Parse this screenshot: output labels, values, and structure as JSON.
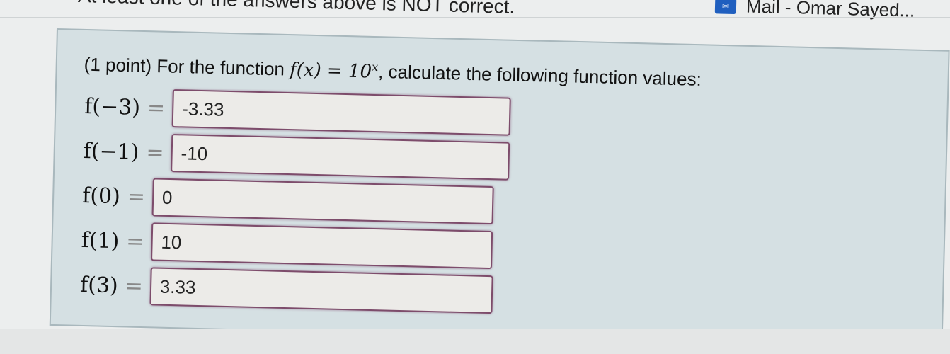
{
  "warning_text": "At least one of the answers above is NOT correct.",
  "taskbar": {
    "mail_label": "Mail - Omar Sayed...",
    "icon": "mail-icon"
  },
  "problem": {
    "points": "(1 point)",
    "intro": "For the function",
    "function": "f(x) = 10",
    "exponent": "x",
    "tail": ", calculate the following function values:"
  },
  "rows": [
    {
      "label": "f(−3)",
      "answer": "-3.33"
    },
    {
      "label": "f(−1)",
      "answer": "-10"
    },
    {
      "label": "f(0)",
      "answer": "0"
    },
    {
      "label": "f(1)",
      "answer": "10"
    },
    {
      "label": "f(3)",
      "answer": "3.33"
    }
  ],
  "colors": {
    "input_border": "#7d4c6b",
    "panel_bg": "#d5e0e3"
  }
}
